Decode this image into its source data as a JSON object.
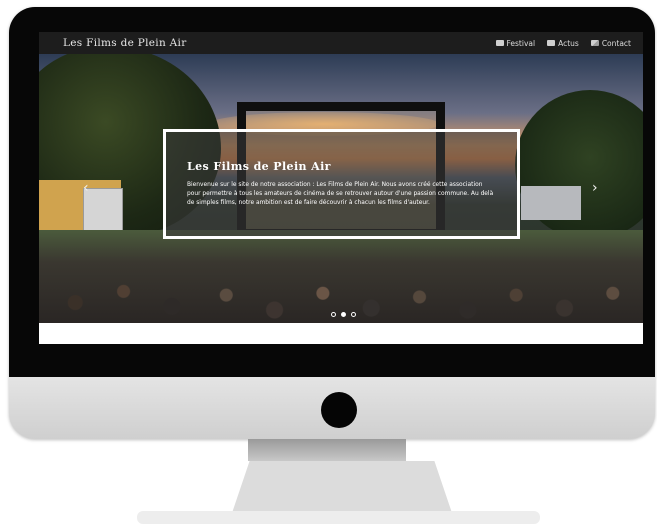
{
  "navbar": {
    "brand": "Les Films de Plein Air",
    "links": [
      {
        "label": "Festival",
        "icon": "film-icon"
      },
      {
        "label": "Actus",
        "icon": "newspaper-icon"
      },
      {
        "label": "Contact",
        "icon": "mail-icon"
      }
    ]
  },
  "hero": {
    "title": "Les Films de Plein Air",
    "text": "Bienvenue sur le site de notre association : Les Films de Plein Air. Nous avons créé cette association pour permettre à tous les amateurs de cinéma de se retrouver autour d'une passion commune. Au delà de simples films, notre ambition est de faire découvrir à chacun les films d'auteur.",
    "prev_icon": "‹",
    "next_icon": "›",
    "active_slide": 1,
    "slide_count": 3
  },
  "colors": {
    "navbar_bg": "#1d1d1d",
    "caption_border": "#ffffff",
    "monitor_bezel": "#070707",
    "monitor_chin": "#d9d9d9"
  }
}
